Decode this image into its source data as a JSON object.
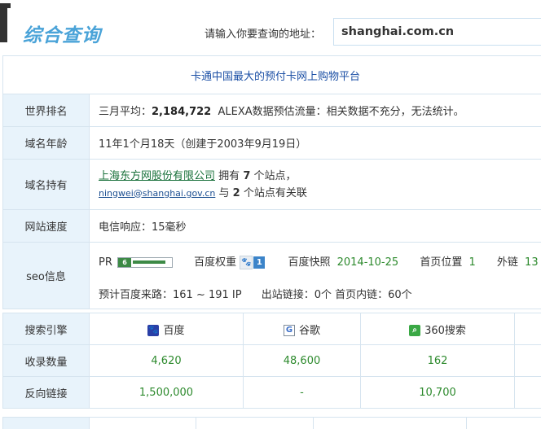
{
  "header": {
    "title": "综合查询",
    "search_label": "请输入你要查询的地址：",
    "search_value": "shanghai.com.cn"
  },
  "info": {
    "slogan": "卡通中国最大的预付卡网上购物平台",
    "rank_label": "世界排名",
    "rank_prefix": "三月平均：",
    "rank_value": "2,184,722",
    "rank_suffix": "ALEXA数据预估流量：相关数据不充分，无法统计。",
    "age_label": "域名年龄",
    "age_value": "11年1个月18天（创建于2003年9月19日）",
    "owner_label": "域名持有",
    "owner_company": "上海东方网股份有限公司",
    "owner_has": "拥有",
    "owner_site_count": "7",
    "owner_sites_suffix": "个站点，",
    "owner_email": "ningwei@shanghai.gov.cn",
    "owner_with": "与",
    "owner_related_count": "2",
    "owner_related_suffix": "个站点有关联",
    "speed_label": "网站速度",
    "speed_value": "电信响应：15毫秒",
    "seo_label": "seo信息",
    "pr_label": "PR",
    "pr_value": "6",
    "bd_weight_label": "百度权重",
    "bd_weight_value": "1",
    "bd_snapshot_label": "百度快照",
    "bd_snapshot_value": "2014-10-25",
    "home_pos_label": "首页位置",
    "home_pos_value": "1",
    "outlinks_label": "外链",
    "outlinks_value": "13",
    "traffic_line": "预计百度来路：161 ~ 191 IP",
    "outbound_line": "出站链接：0个 首页内链：60个"
  },
  "engines": {
    "header_label": "搜索引擎",
    "names": [
      "百度",
      "谷歌",
      "360搜索"
    ],
    "icons": [
      "baidu-paw-icon",
      "google-g-icon",
      "360-search-icon"
    ],
    "indexed_label": "收录数量",
    "indexed": [
      "4,620",
      "48,600",
      "162"
    ],
    "backlinks_label": "反向链接",
    "backlinks": [
      "1,500,000",
      "-",
      "10,700"
    ]
  },
  "colors": {
    "title_blue": "#4aa3d8",
    "label_bg": "#e8f3fb",
    "value_green": "#2d8a2d",
    "slogan_blue": "#1b4fa5"
  }
}
